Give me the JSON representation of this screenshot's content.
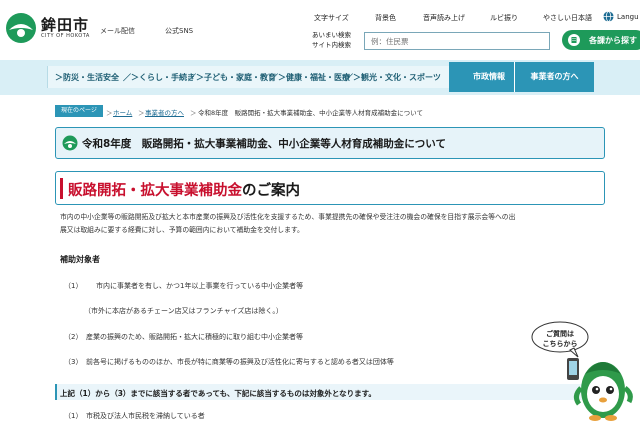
{
  "header": {
    "logo_jp": "鉾田市",
    "logo_en": "CITY OF HOKOTA",
    "links": [
      "メール配信",
      "公式SNS"
    ],
    "utilities": [
      "文字サイズ",
      "背景色",
      "音声読み上げ",
      "ルビ振り",
      "やさしい日本語",
      "Langu"
    ],
    "search_label_lines": [
      "あいまい検索",
      "サイト内検索"
    ],
    "search_placeholder": "例：住民票",
    "search_button": "各課から探す"
  },
  "nav": {
    "items": [
      "防災・生活安全",
      "くらし・手続き",
      "子ども・家庭・教育",
      "健康・福祉・医療",
      "観光・文化・スポーツ"
    ],
    "buttons": [
      "市政情報",
      "事業者の方へ"
    ]
  },
  "breadcrumb": {
    "tag": "現在のページ",
    "items": [
      "ホーム",
      "事業者の方へ",
      "令和8年度　販路開拓・拡大事業補助金、中小企業等人材育成補助金について"
    ]
  },
  "page": {
    "title": "令和8年度　販路開拓・拡大事業補助金、中小企業等人材育成補助金について",
    "section_title_red": "販路開拓・拡大事業補助金",
    "section_title_rest": "のご案内",
    "intro_lines": [
      "市内の中小企業等の販路開拓及び拡大と本市産業の振興及び活性化を支援するため、事業提携先の確保や受注注の機会の確保を目指す展示会等への出",
      "展又は取組みに要する経費に対し、予算の範囲内において補助金を交付します。"
    ],
    "target_heading": "補助対象者",
    "targets": [
      {
        "num": "（1）",
        "text": "市内に事業者を有し、かつ1年以上事業を行っている中小企業者等"
      },
      {
        "num": "",
        "text": "（市外に本店があるチェーン店又はフランチャイズ店は除く。）"
      },
      {
        "num": "（2）",
        "text": "産業の振興のため、販路開拓・拡大に積極的に取り組む中小企業者等"
      },
      {
        "num": "（3）",
        "text": "前各号に掲げるもののほか、市長が特に商業等の振興及び活性化に寄与すると認める者又は団体等"
      }
    ],
    "exclusion_note": "上記（1）から（3）までに該当する者であっても、下記に該当するものは対象外となります。",
    "exclusions": [
      {
        "num": "（1）",
        "text": "市税及び法人市民税を滞納している者"
      }
    ]
  },
  "mascot": {
    "bubble_lines": [
      "ご質問は",
      "こちらから"
    ]
  },
  "colors": {
    "accent": "#2c95b6",
    "nav_bg": "#d9eff6",
    "title_red": "#c8102e",
    "search_green": "#1e9a5a"
  }
}
